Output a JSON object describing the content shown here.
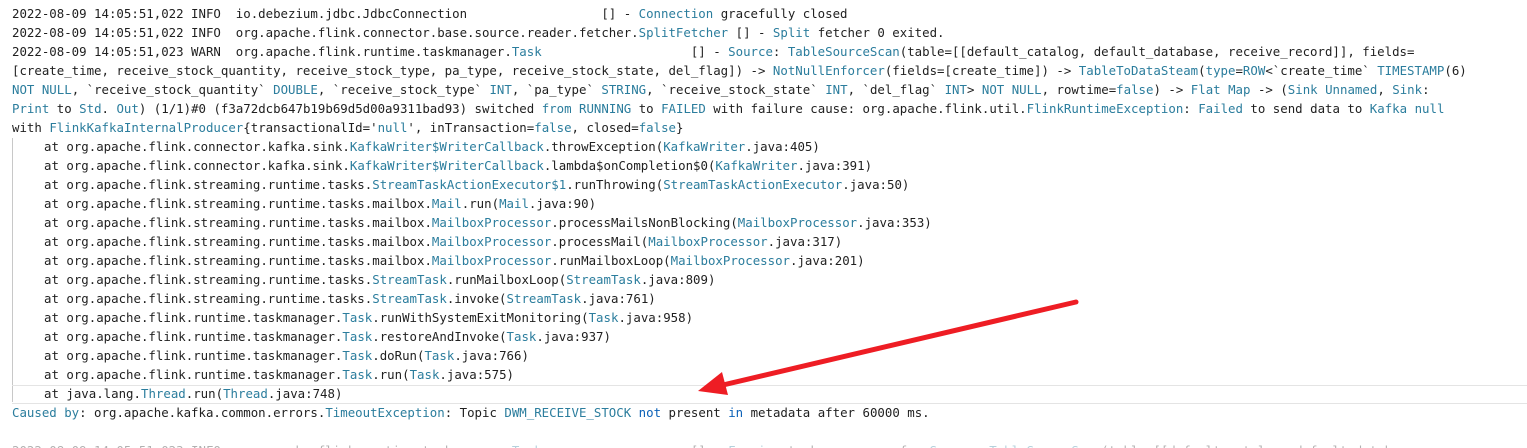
{
  "log": [
    {
      "indent": false,
      "segments": [
        {
          "t": "2022-08-09 14:05:51,022 INFO  io.debezium.jdbc.JdbcConnection                  [] - ",
          "c": "dark"
        },
        {
          "t": "Connection",
          "c": "cyan"
        },
        {
          "t": " gracefully closed",
          "c": "dark"
        }
      ]
    },
    {
      "indent": false,
      "segments": [
        {
          "t": "2022-08-09 14:05:51,022 INFO  org.apache.flink.connector.base.source.reader.fetcher.",
          "c": "dark"
        },
        {
          "t": "SplitFetcher",
          "c": "cyan"
        },
        {
          "t": " [] - ",
          "c": "dark"
        },
        {
          "t": "Split",
          "c": "cyan"
        },
        {
          "t": " fetcher 0 exited.",
          "c": "dark"
        }
      ]
    },
    {
      "indent": false,
      "segments": [
        {
          "t": "2022-08-09 14:05:51,023 WARN  org.apache.flink.runtime.taskmanager.",
          "c": "dark"
        },
        {
          "t": "Task",
          "c": "cyan"
        },
        {
          "t": "                    [] - ",
          "c": "dark"
        },
        {
          "t": "Source",
          "c": "cyan"
        },
        {
          "t": ": ",
          "c": "dark"
        },
        {
          "t": "TableSourceScan",
          "c": "cyan"
        },
        {
          "t": "(table=[[default_catalog, default_database, receive_record]], fields=",
          "c": "dark"
        }
      ]
    },
    {
      "indent": false,
      "segments": [
        {
          "t": "[create_time, receive_stock_quantity, receive_stock_type, pa_type, receive_stock_state, del_flag]) -> ",
          "c": "dark"
        },
        {
          "t": "NotNullEnforcer",
          "c": "cyan"
        },
        {
          "t": "(fields=[create_time]) -> ",
          "c": "dark"
        },
        {
          "t": "TableToDataSteam",
          "c": "cyan"
        },
        {
          "t": "(",
          "c": "dark"
        },
        {
          "t": "type",
          "c": "cyan"
        },
        {
          "t": "=",
          "c": "dark"
        },
        {
          "t": "ROW",
          "c": "cyan"
        },
        {
          "t": "<`create_time` ",
          "c": "dark"
        },
        {
          "t": "TIMESTAMP",
          "c": "cyan"
        },
        {
          "t": "(6)",
          "c": "dark"
        }
      ]
    },
    {
      "indent": false,
      "segments": [
        {
          "t": "NOT NULL",
          "c": "cyan"
        },
        {
          "t": ", `receive_stock_quantity` ",
          "c": "dark"
        },
        {
          "t": "DOUBLE",
          "c": "cyan"
        },
        {
          "t": ", `receive_stock_type` ",
          "c": "dark"
        },
        {
          "t": "INT",
          "c": "cyan"
        },
        {
          "t": ", `pa_type` ",
          "c": "dark"
        },
        {
          "t": "STRING",
          "c": "cyan"
        },
        {
          "t": ", `receive_stock_state` ",
          "c": "dark"
        },
        {
          "t": "INT",
          "c": "cyan"
        },
        {
          "t": ", `del_flag` ",
          "c": "dark"
        },
        {
          "t": "INT",
          "c": "cyan"
        },
        {
          "t": "> ",
          "c": "dark"
        },
        {
          "t": "NOT NULL",
          "c": "cyan"
        },
        {
          "t": ", rowtime=",
          "c": "dark"
        },
        {
          "t": "false",
          "c": "cyan"
        },
        {
          "t": ") -> ",
          "c": "dark"
        },
        {
          "t": "Flat Map",
          "c": "cyan"
        },
        {
          "t": " -> (",
          "c": "dark"
        },
        {
          "t": "Sink Unnamed",
          "c": "cyan"
        },
        {
          "t": ", ",
          "c": "dark"
        },
        {
          "t": "Sink",
          "c": "cyan"
        },
        {
          "t": ":",
          "c": "dark"
        }
      ]
    },
    {
      "indent": false,
      "segments": [
        {
          "t": "Print",
          "c": "cyan"
        },
        {
          "t": " to ",
          "c": "dark"
        },
        {
          "t": "Std",
          "c": "cyan"
        },
        {
          "t": ". ",
          "c": "dark"
        },
        {
          "t": "Out",
          "c": "cyan"
        },
        {
          "t": ") (1/1)#0 (f3a72dcb647b19b69d5d00a9311bad93) switched ",
          "c": "dark"
        },
        {
          "t": "from",
          "c": "cyan"
        },
        {
          "t": " ",
          "c": "dark"
        },
        {
          "t": "RUNNING",
          "c": "cyan"
        },
        {
          "t": " to ",
          "c": "dark"
        },
        {
          "t": "FAILED",
          "c": "cyan"
        },
        {
          "t": " with failure cause: org.apache.flink.util.",
          "c": "dark"
        },
        {
          "t": "FlinkRuntimeException",
          "c": "cyan"
        },
        {
          "t": ": ",
          "c": "dark"
        },
        {
          "t": "Failed",
          "c": "cyan"
        },
        {
          "t": " to send data to ",
          "c": "dark"
        },
        {
          "t": "Kafka",
          "c": "cyan"
        },
        {
          "t": " ",
          "c": "dark"
        },
        {
          "t": "null",
          "c": "cyan"
        }
      ]
    },
    {
      "indent": false,
      "segments": [
        {
          "t": "with ",
          "c": "dark"
        },
        {
          "t": "FlinkKafkaInternalProducer",
          "c": "cyan"
        },
        {
          "t": "{transactionalId='",
          "c": "dark"
        },
        {
          "t": "null",
          "c": "cyan"
        },
        {
          "t": "', inTransaction=",
          "c": "dark"
        },
        {
          "t": "false",
          "c": "cyan"
        },
        {
          "t": ", closed=",
          "c": "dark"
        },
        {
          "t": "false",
          "c": "cyan"
        },
        {
          "t": "}",
          "c": "dark"
        }
      ]
    },
    {
      "indent": true,
      "segments": [
        {
          "t": "at org.apache.flink.connector.kafka.sink.",
          "c": "dark"
        },
        {
          "t": "KafkaWriter$WriterCallback",
          "c": "cyan"
        },
        {
          "t": ".throwException(",
          "c": "dark"
        },
        {
          "t": "KafkaWriter",
          "c": "cyan"
        },
        {
          "t": ".java:405)",
          "c": "dark"
        }
      ]
    },
    {
      "indent": true,
      "segments": [
        {
          "t": "at org.apache.flink.connector.kafka.sink.",
          "c": "dark"
        },
        {
          "t": "KafkaWriter$WriterCallback",
          "c": "cyan"
        },
        {
          "t": ".lambda$onCompletion$0(",
          "c": "dark"
        },
        {
          "t": "KafkaWriter",
          "c": "cyan"
        },
        {
          "t": ".java:391)",
          "c": "dark"
        }
      ]
    },
    {
      "indent": true,
      "segments": [
        {
          "t": "at org.apache.flink.streaming.runtime.tasks.",
          "c": "dark"
        },
        {
          "t": "StreamTaskActionExecutor$1",
          "c": "cyan"
        },
        {
          "t": ".runThrowing(",
          "c": "dark"
        },
        {
          "t": "StreamTaskActionExecutor",
          "c": "cyan"
        },
        {
          "t": ".java:50)",
          "c": "dark"
        }
      ]
    },
    {
      "indent": true,
      "segments": [
        {
          "t": "at org.apache.flink.streaming.runtime.tasks.mailbox.",
          "c": "dark"
        },
        {
          "t": "Mail",
          "c": "cyan"
        },
        {
          "t": ".run(",
          "c": "dark"
        },
        {
          "t": "Mail",
          "c": "cyan"
        },
        {
          "t": ".java:90)",
          "c": "dark"
        }
      ]
    },
    {
      "indent": true,
      "segments": [
        {
          "t": "at org.apache.flink.streaming.runtime.tasks.mailbox.",
          "c": "dark"
        },
        {
          "t": "MailboxProcessor",
          "c": "cyan"
        },
        {
          "t": ".processMailsNonBlocking(",
          "c": "dark"
        },
        {
          "t": "MailboxProcessor",
          "c": "cyan"
        },
        {
          "t": ".java:353)",
          "c": "dark"
        }
      ]
    },
    {
      "indent": true,
      "segments": [
        {
          "t": "at org.apache.flink.streaming.runtime.tasks.mailbox.",
          "c": "dark"
        },
        {
          "t": "MailboxProcessor",
          "c": "cyan"
        },
        {
          "t": ".processMail(",
          "c": "dark"
        },
        {
          "t": "MailboxProcessor",
          "c": "cyan"
        },
        {
          "t": ".java:317)",
          "c": "dark"
        }
      ]
    },
    {
      "indent": true,
      "segments": [
        {
          "t": "at org.apache.flink.streaming.runtime.tasks.mailbox.",
          "c": "dark"
        },
        {
          "t": "MailboxProcessor",
          "c": "cyan"
        },
        {
          "t": ".runMailboxLoop(",
          "c": "dark"
        },
        {
          "t": "MailboxProcessor",
          "c": "cyan"
        },
        {
          "t": ".java:201)",
          "c": "dark"
        }
      ]
    },
    {
      "indent": true,
      "segments": [
        {
          "t": "at org.apache.flink.streaming.runtime.tasks.",
          "c": "dark"
        },
        {
          "t": "StreamTask",
          "c": "cyan"
        },
        {
          "t": ".runMailboxLoop(",
          "c": "dark"
        },
        {
          "t": "StreamTask",
          "c": "cyan"
        },
        {
          "t": ".java:809)",
          "c": "dark"
        }
      ]
    },
    {
      "indent": true,
      "segments": [
        {
          "t": "at org.apache.flink.streaming.runtime.tasks.",
          "c": "dark"
        },
        {
          "t": "StreamTask",
          "c": "cyan"
        },
        {
          "t": ".invoke(",
          "c": "dark"
        },
        {
          "t": "StreamTask",
          "c": "cyan"
        },
        {
          "t": ".java:761)",
          "c": "dark"
        }
      ]
    },
    {
      "indent": true,
      "segments": [
        {
          "t": "at org.apache.flink.runtime.taskmanager.",
          "c": "dark"
        },
        {
          "t": "Task",
          "c": "cyan"
        },
        {
          "t": ".runWithSystemExitMonitoring(",
          "c": "dark"
        },
        {
          "t": "Task",
          "c": "cyan"
        },
        {
          "t": ".java:958)",
          "c": "dark"
        }
      ]
    },
    {
      "indent": true,
      "segments": [
        {
          "t": "at org.apache.flink.runtime.taskmanager.",
          "c": "dark"
        },
        {
          "t": "Task",
          "c": "cyan"
        },
        {
          "t": ".restoreAndInvoke(",
          "c": "dark"
        },
        {
          "t": "Task",
          "c": "cyan"
        },
        {
          "t": ".java:937)",
          "c": "dark"
        }
      ]
    },
    {
      "indent": true,
      "segments": [
        {
          "t": "at org.apache.flink.runtime.taskmanager.",
          "c": "dark"
        },
        {
          "t": "Task",
          "c": "cyan"
        },
        {
          "t": ".doRun(",
          "c": "dark"
        },
        {
          "t": "Task",
          "c": "cyan"
        },
        {
          "t": ".java:766)",
          "c": "dark"
        }
      ]
    },
    {
      "indent": true,
      "segments": [
        {
          "t": "at org.apache.flink.runtime.taskmanager.",
          "c": "dark"
        },
        {
          "t": "Task",
          "c": "cyan"
        },
        {
          "t": ".run(",
          "c": "dark"
        },
        {
          "t": "Task",
          "c": "cyan"
        },
        {
          "t": ".java:575)",
          "c": "dark"
        }
      ]
    },
    {
      "indent": true,
      "segments": [
        {
          "t": "at java.lang.",
          "c": "dark"
        },
        {
          "t": "Thread",
          "c": "cyan"
        },
        {
          "t": ".run(",
          "c": "dark"
        },
        {
          "t": "Thread",
          "c": "cyan"
        },
        {
          "t": ".java:748)",
          "c": "dark"
        }
      ]
    },
    {
      "indent": false,
      "segments": [
        {
          "t": "Caused by",
          "c": "cyan"
        },
        {
          "t": ": org.apache.kafka.common.errors.",
          "c": "dark"
        },
        {
          "t": "TimeoutException",
          "c": "cyan"
        },
        {
          "t": ": Topic ",
          "c": "dark"
        },
        {
          "t": "DWM_RECEIVE_STOCK",
          "c": "cyan"
        },
        {
          "t": " ",
          "c": "dark"
        },
        {
          "t": "not",
          "c": "blue"
        },
        {
          "t": " present ",
          "c": "dark"
        },
        {
          "t": "in",
          "c": "blue"
        },
        {
          "t": " metadata after 60000 ms.",
          "c": "dark"
        }
      ]
    },
    {
      "indent": false,
      "segments": [
        {
          "t": "",
          "c": "dark"
        }
      ]
    },
    {
      "indent": false,
      "partial": true,
      "segments": [
        {
          "t": "2022-08-09 14:05:51,023 INFO  org.apache.flink.runtime.taskmanager.",
          "c": "dark"
        },
        {
          "t": "Task",
          "c": "cyan"
        },
        {
          "t": "                    [] - ",
          "c": "dark"
        },
        {
          "t": "Freeing",
          "c": "cyan"
        },
        {
          "t": " task resources for ",
          "c": "dark"
        },
        {
          "t": "Source",
          "c": "cyan"
        },
        {
          "t": ": ",
          "c": "dark"
        },
        {
          "t": "TableSourceScan",
          "c": "cyan"
        },
        {
          "t": "(table=[[default_catalog, default_database",
          "c": "dark"
        }
      ]
    }
  ],
  "annotation": {
    "arrow_color": "#ee1d24",
    "target_line": 20
  }
}
